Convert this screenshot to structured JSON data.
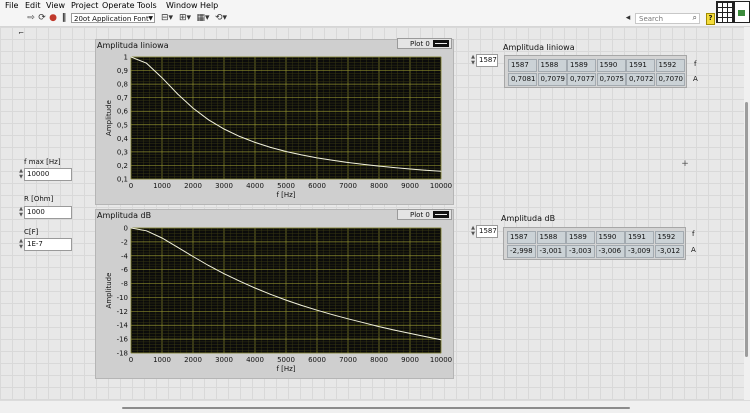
{
  "menu": [
    "File",
    "Edit",
    "View",
    "Project",
    "Operate",
    "Tools",
    "Window",
    "Help"
  ],
  "toolbar": {
    "font": "20ot Application Font",
    "search_placeholder": "Search",
    "help": "?"
  },
  "controls": {
    "fmax": {
      "label": "f max [Hz]",
      "value": "10000"
    },
    "r": {
      "label": "R [Ohm]",
      "value": "1000"
    },
    "c": {
      "label": "C[F]",
      "value": "1E-7"
    }
  },
  "graph_linear": {
    "label": "Amplituda liniowa",
    "legend": "Plot 0",
    "xlabel": "f [Hz]",
    "ylabel": "Amplitude",
    "xticks": [
      "0",
      "1000",
      "2000",
      "3000",
      "4000",
      "5000",
      "6000",
      "7000",
      "8000",
      "9000",
      "10000"
    ],
    "yticks": [
      "1",
      "0,9",
      "0,8",
      "0,7",
      "0,6",
      "0,5",
      "0,4",
      "0,3",
      "0,2",
      "0,1"
    ]
  },
  "graph_db": {
    "label": "Amplituda dB",
    "legend": "Plot 0",
    "xlabel": "f [Hz]",
    "ylabel": "Amplitude",
    "xticks": [
      "0",
      "1000",
      "2000",
      "3000",
      "4000",
      "5000",
      "6000",
      "7000",
      "8000",
      "9000",
      "10000"
    ],
    "yticks": [
      "0",
      "-2",
      "-4",
      "-6",
      "-8",
      "-10",
      "-12",
      "-14",
      "-16",
      "-18"
    ]
  },
  "array_linear": {
    "label": "Amplituda liniowa",
    "index": "1587",
    "f_values": [
      "1587",
      "1588",
      "1589",
      "1590",
      "1591",
      "1592"
    ],
    "a_values": [
      "0,7081",
      "0,7079",
      "0,7077",
      "0,7075",
      "0,7072",
      "0,7070"
    ],
    "row_f": "f",
    "row_a": "A"
  },
  "array_db": {
    "label": "Amplituda dB",
    "index": "1587",
    "f_values": [
      "1587",
      "1588",
      "1589",
      "1590",
      "1591",
      "1592"
    ],
    "a_values": [
      "-2,998",
      "-3,001",
      "-3,003",
      "-3,006",
      "-3,009",
      "-3,012"
    ],
    "row_f": "f",
    "row_a": "A"
  },
  "chart_data": [
    {
      "type": "line",
      "title": "Amplituda liniowa",
      "xlabel": "f [Hz]",
      "ylabel": "Amplitude",
      "xlim": [
        0,
        10000
      ],
      "ylim": [
        0.1,
        1
      ],
      "grid": true,
      "legend": "top-right",
      "series": [
        {
          "name": "Plot 0",
          "x": [
            0,
            500,
            1000,
            1500,
            2000,
            2500,
            3000,
            3500,
            4000,
            4500,
            5000,
            5500,
            6000,
            6500,
            7000,
            7500,
            8000,
            8500,
            9000,
            9500,
            10000
          ],
          "values": [
            1,
            0.954,
            0.847,
            0.728,
            0.623,
            0.537,
            0.469,
            0.414,
            0.37,
            0.333,
            0.303,
            0.278,
            0.256,
            0.238,
            0.222,
            0.208,
            0.195,
            0.184,
            0.174,
            0.165,
            0.157
          ]
        }
      ]
    },
    {
      "type": "line",
      "title": "Amplituda dB",
      "xlabel": "f [Hz]",
      "ylabel": "Amplitude",
      "xlim": [
        0,
        10000
      ],
      "ylim": [
        -18,
        0
      ],
      "grid": true,
      "legend": "top-right",
      "series": [
        {
          "name": "Plot 0",
          "x": [
            0,
            500,
            1000,
            1500,
            2000,
            2500,
            3000,
            3500,
            4000,
            4500,
            5000,
            5500,
            6000,
            6500,
            7000,
            7500,
            8000,
            8500,
            9000,
            9500,
            10000
          ],
          "values": [
            0,
            -0.41,
            -1.44,
            -2.76,
            -4.11,
            -5.4,
            -6.58,
            -7.65,
            -8.64,
            -9.55,
            -10.38,
            -11.15,
            -11.84,
            -12.48,
            -13.08,
            -13.64,
            -14.2,
            -14.7,
            -15.18,
            -15.64,
            -16.08
          ]
        }
      ]
    }
  ]
}
